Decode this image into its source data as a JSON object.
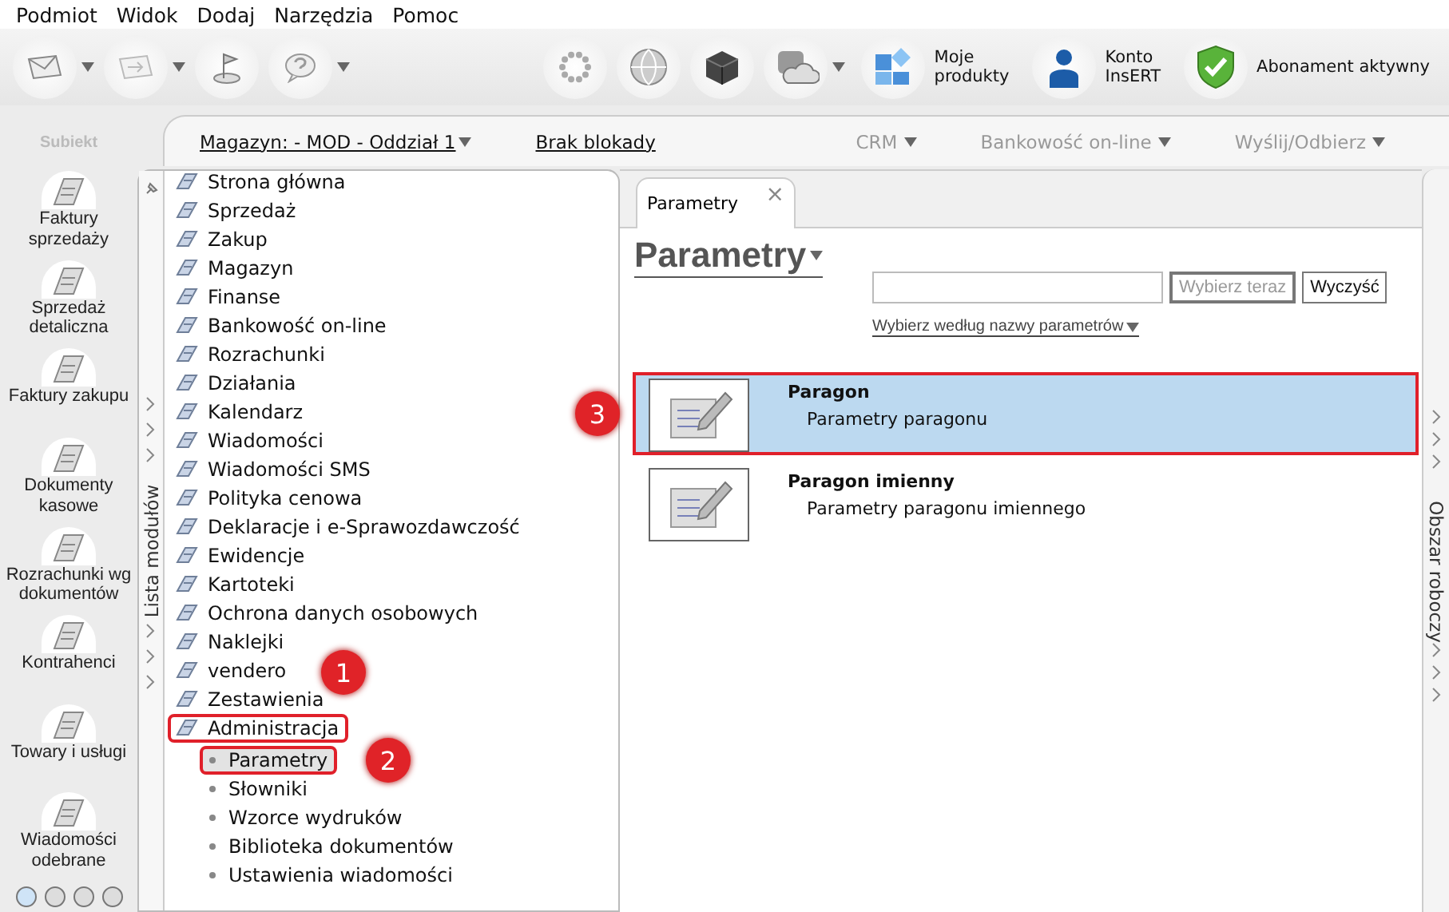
{
  "menu": [
    "Podmiot",
    "Widok",
    "Dodaj",
    "Narzędzia",
    "Pomoc"
  ],
  "toolbar": {
    "tools": [
      {
        "kind": "envelope",
        "caret": true
      },
      {
        "kind": "forward",
        "caret": true
      },
      {
        "kind": "flag",
        "caret": false
      },
      {
        "kind": "help",
        "caret": true
      },
      {
        "kind": "spinner",
        "caret": false
      },
      {
        "kind": "globe",
        "caret": false
      },
      {
        "kind": "cube",
        "caret": false
      },
      {
        "kind": "cloud",
        "caret": true
      }
    ],
    "buttons": [
      {
        "kind": "tiles",
        "label": "Moje\nprodukty"
      },
      {
        "kind": "person",
        "label": "Konto\nInsERT"
      },
      {
        "kind": "shield",
        "label": "Abonament aktywny"
      }
    ]
  },
  "app_name": "Subiekt",
  "nav": {
    "items": [
      {
        "label": "Faktury sprzedaży"
      },
      {
        "label": "Sprzedaż detaliczna"
      },
      {
        "label": "Faktury zakupu"
      },
      {
        "label": "Dokumenty kasowe"
      },
      {
        "label": "Rozrachunki wg dokumentów"
      },
      {
        "label": "Kontrahenci"
      },
      {
        "label": "Towary i usługi"
      },
      {
        "label": "Wiadomości odebrane"
      }
    ]
  },
  "workspace_bar": {
    "warehouse": "Magazyn: - MOD - Oddział 1",
    "lock": "Brak blokady",
    "actions": [
      {
        "label": "CRM",
        "disabled": true
      },
      {
        "label": "Bankowość on-line",
        "disabled": true
      },
      {
        "label": "Wyślij/Odbierz",
        "disabled": true
      }
    ]
  },
  "module_list": {
    "title": "Lista modułów",
    "items": [
      {
        "label": "Strona główna",
        "annotated": false
      },
      {
        "label": "Sprzedaż",
        "annotated": false
      },
      {
        "label": "Zakup",
        "annotated": false
      },
      {
        "label": "Magazyn",
        "annotated": false
      },
      {
        "label": "Finanse",
        "annotated": false
      },
      {
        "label": "Bankowość on-line",
        "annotated": false
      },
      {
        "label": "Rozrachunki",
        "annotated": false
      },
      {
        "label": "Działania",
        "annotated": false
      },
      {
        "label": "Kalendarz",
        "annotated": false
      },
      {
        "label": "Wiadomości",
        "annotated": false
      },
      {
        "label": "Wiadomości SMS",
        "annotated": false
      },
      {
        "label": "Polityka cenowa",
        "annotated": false
      },
      {
        "label": "Deklaracje i e-Sprawozdawczość",
        "annotated": false
      },
      {
        "label": "Ewidencje",
        "annotated": false
      },
      {
        "label": "Kartoteki",
        "annotated": false
      },
      {
        "label": "Ochrona danych osobowych",
        "annotated": false
      },
      {
        "label": "Naklejki",
        "annotated": false
      },
      {
        "label": "vendero",
        "annotated": false,
        "callout": "1"
      },
      {
        "label": "Zestawienia",
        "annotated": false
      },
      {
        "label": "Administracja",
        "annotated": true,
        "children": [
          {
            "label": "Parametry",
            "annotated": true,
            "selected": true,
            "callout": "2"
          },
          {
            "label": "Słowniki",
            "annotated": false,
            "selected": false
          },
          {
            "label": "Wzorce wydruków",
            "annotated": false,
            "selected": false
          },
          {
            "label": "Biblioteka dokumentów",
            "annotated": false,
            "selected": false
          },
          {
            "label": "Ustawienia wiadomości",
            "annotated": false,
            "selected": false
          }
        ]
      }
    ]
  },
  "tab": {
    "label": "Parametry",
    "close": "×"
  },
  "heading": "Parametry",
  "search": {
    "button": "Wybierz teraz",
    "clear": "Wyczyść",
    "filter": "Wybierz według nazwy parametrów"
  },
  "rows": [
    {
      "title": "Paragon",
      "subtitle": "Parametry paragonu",
      "selected": true,
      "annotated": true,
      "callout": "3"
    },
    {
      "title": "Paragon imienny",
      "subtitle": "Parametry paragonu imiennego",
      "selected": false,
      "annotated": false
    }
  ],
  "side_panel": {
    "title": "Obszar roboczy"
  }
}
